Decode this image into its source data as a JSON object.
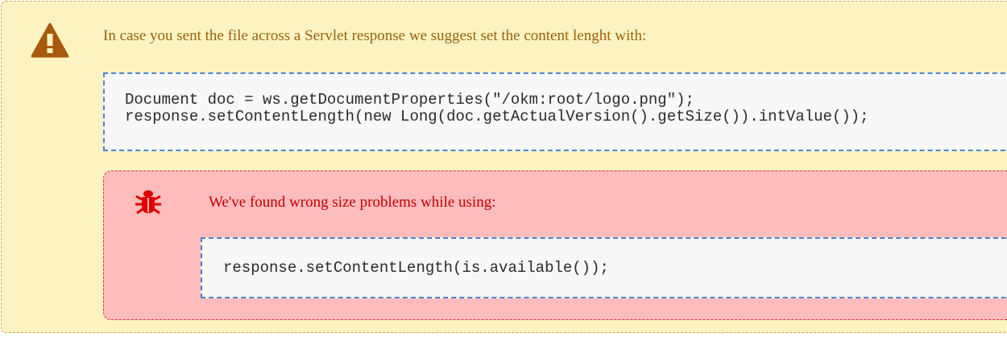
{
  "warning": {
    "icon": "warning-triangle-icon",
    "color": "#a85a0c",
    "text": "In case you sent the file across a Servlet response we suggest set the content lenght with:",
    "code_lines": [
      "Document doc = ws.getDocumentProperties(\"/okm:root/logo.png\");",
      "response.setContentLength(new Long(doc.getActualVersion().getSize()).intValue());"
    ]
  },
  "error": {
    "icon": "bug-icon",
    "color": "#e00000",
    "text": "We've found wrong size problems while using:",
    "code_lines": [
      "response.setContentLength(is.available());"
    ]
  }
}
